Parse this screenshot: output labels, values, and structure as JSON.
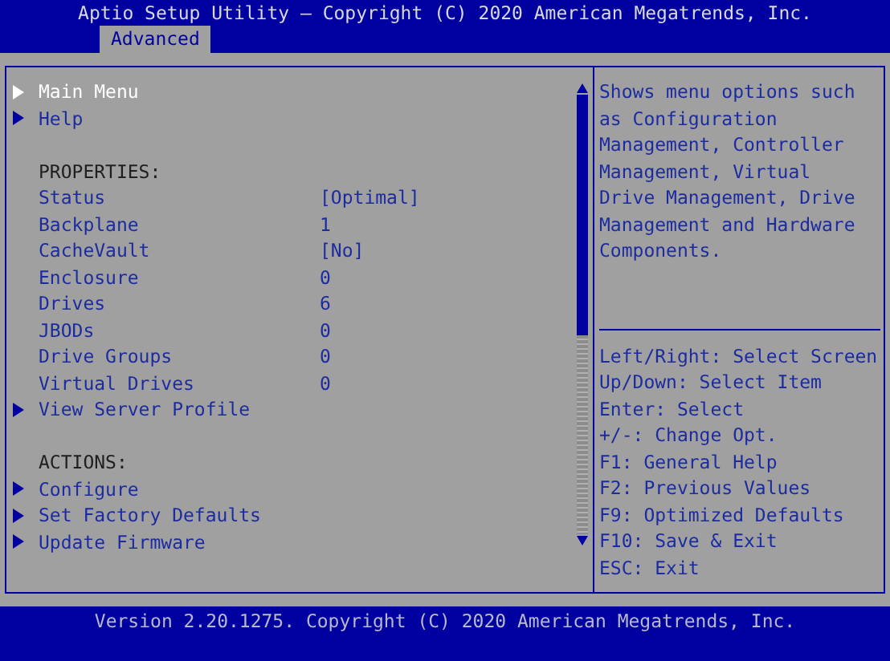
{
  "title": "Aptio Setup Utility – Copyright (C) 2020 American Megatrends, Inc.",
  "tabs": [
    {
      "label": "Advanced",
      "selected": true
    }
  ],
  "menu": {
    "sections": [
      {
        "items": [
          {
            "kind": "submenu",
            "label": "Main Menu",
            "selected": true
          },
          {
            "kind": "submenu",
            "label": "Help",
            "selected": false
          }
        ]
      },
      {
        "items": [
          {
            "kind": "header",
            "label": "PROPERTIES:"
          },
          {
            "kind": "property",
            "label": "Status",
            "value": "[Optimal]"
          },
          {
            "kind": "property",
            "label": "Backplane",
            "value": "1"
          },
          {
            "kind": "property",
            "label": "CacheVault",
            "value": "[No]"
          },
          {
            "kind": "property",
            "label": "Enclosure",
            "value": "0"
          },
          {
            "kind": "property",
            "label": "Drives",
            "value": "6"
          },
          {
            "kind": "property",
            "label": "JBODs",
            "value": "0"
          },
          {
            "kind": "property",
            "label": "Drive Groups",
            "value": "0"
          },
          {
            "kind": "property",
            "label": "Virtual Drives",
            "value": "0"
          },
          {
            "kind": "submenu",
            "label": "View Server Profile",
            "selected": false
          }
        ]
      },
      {
        "items": [
          {
            "kind": "header",
            "label": "ACTIONS:"
          },
          {
            "kind": "submenu",
            "label": "Configure",
            "selected": false
          },
          {
            "kind": "submenu",
            "label": "Set Factory Defaults",
            "selected": false
          },
          {
            "kind": "submenu",
            "label": "Update Firmware",
            "selected": false
          }
        ]
      }
    ]
  },
  "help": {
    "description": "Shows menu options such as Configuration Management, Controller Management, Virtual Drive Management, Drive Management and Hardware Components.",
    "keys": [
      "Left/Right: Select Screen",
      "Up/Down: Select Item",
      "Enter: Select",
      "+/-: Change Opt.",
      "F1: General Help",
      "F2: Previous Values",
      "F9: Optimized Defaults",
      "F10: Save & Exit",
      "ESC: Exit"
    ]
  },
  "footer": "Version 2.20.1275. Copyright (C) 2020 American Megatrends, Inc."
}
